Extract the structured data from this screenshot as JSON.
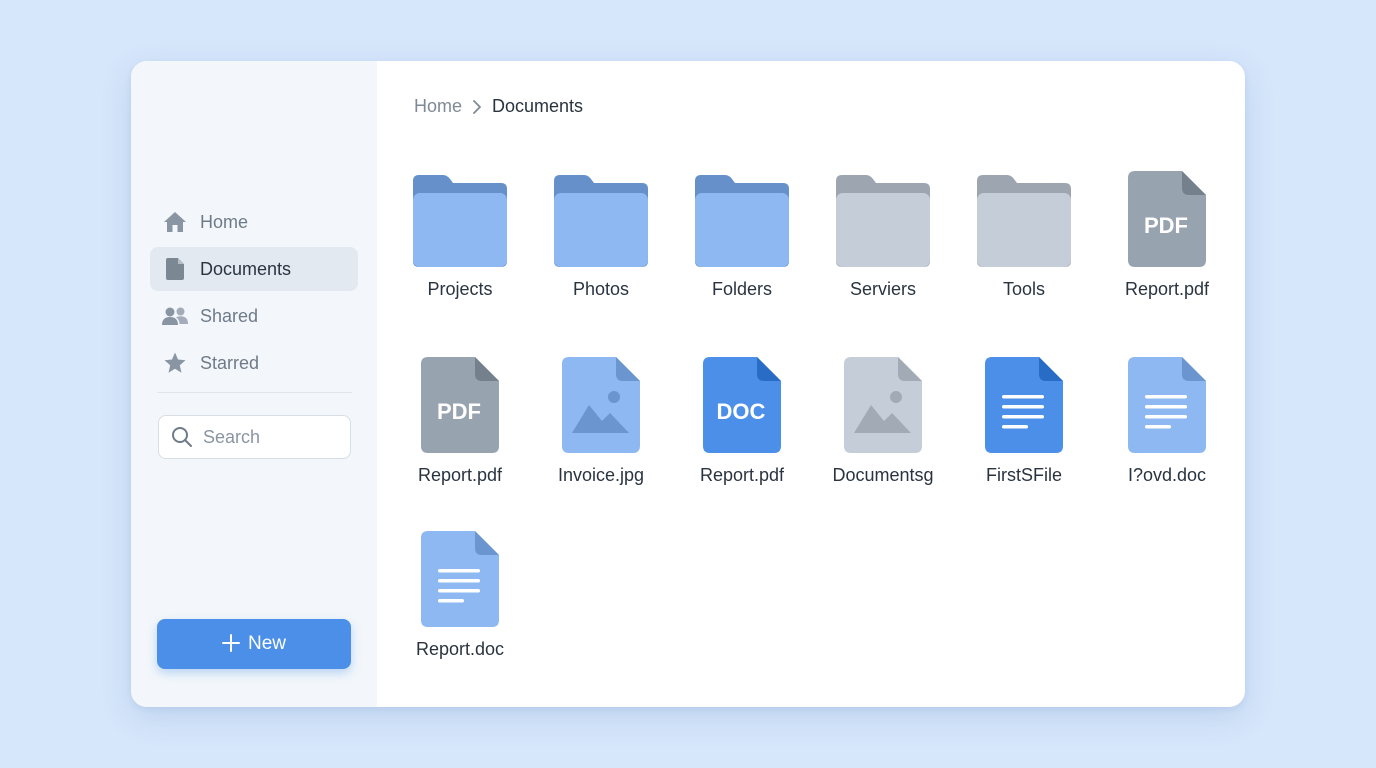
{
  "sidebar": {
    "nav": [
      {
        "label": "Home",
        "icon": "home-icon",
        "active": false
      },
      {
        "label": "Documents",
        "icon": "document-icon",
        "active": true
      },
      {
        "label": "Shared",
        "icon": "people-icon",
        "active": false
      },
      {
        "label": "Starred",
        "icon": "star-icon",
        "active": false
      }
    ],
    "search_placeholder": "Search",
    "new_button_label": "New"
  },
  "breadcrumb": {
    "home": "Home",
    "current": "Documents"
  },
  "files": [
    {
      "name": "Projects",
      "type": "folder",
      "color": "#8db8f2"
    },
    {
      "name": "Photos",
      "type": "folder",
      "color": "#8db8f2"
    },
    {
      "name": "Folders",
      "type": "folder",
      "color": "#8db8f2"
    },
    {
      "name": "Serviers",
      "type": "folder",
      "color": "#c5ced8"
    },
    {
      "name": "Tools",
      "type": "folder",
      "color": "#c5ced8"
    },
    {
      "name": "Report.pdf",
      "type": "pdf",
      "color": "#98a3b0",
      "badge": "PDF"
    },
    {
      "name": "Report.pdf",
      "type": "pdf",
      "color": "#98a3b0",
      "badge": "PDF"
    },
    {
      "name": "Invoice.jpg",
      "type": "image",
      "color": "#8db8f2"
    },
    {
      "name": "Report.pdf",
      "type": "doc",
      "color": "#4b8fe8",
      "badge": "DOC"
    },
    {
      "name": "Documentsg",
      "type": "image",
      "color": "#c5ced8"
    },
    {
      "name": "FirstSFile",
      "type": "text",
      "color": "#4b8fe8"
    },
    {
      "name": "I?ovd.doc",
      "type": "text",
      "color": "#8db8f2"
    },
    {
      "name": "Report.doc",
      "type": "text",
      "color": "#8db8f2"
    }
  ]
}
